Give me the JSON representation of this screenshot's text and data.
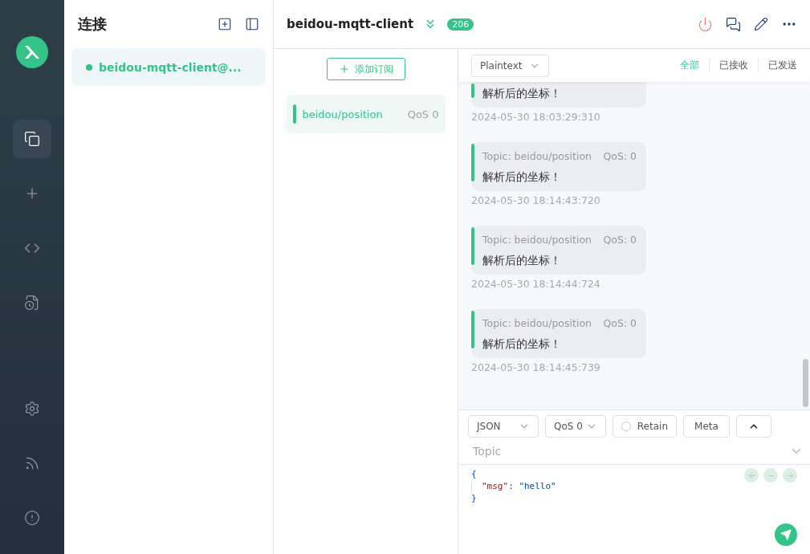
{
  "nav": {
    "items": [
      {
        "kind": "connections",
        "selected": true
      },
      {
        "kind": "new",
        "selected": false
      },
      {
        "kind": "script",
        "selected": false
      },
      {
        "kind": "log",
        "selected": false
      }
    ],
    "bottom": [
      {
        "kind": "settings"
      },
      {
        "kind": "feed"
      },
      {
        "kind": "about"
      }
    ]
  },
  "connections": {
    "title": "连接",
    "items": [
      {
        "name": "beidou-mqtt-client@...",
        "connected": true,
        "selected": true
      }
    ]
  },
  "header": {
    "title": "beidou-mqtt-client",
    "badge": "206"
  },
  "subscriptions": {
    "add_label": "添加订阅",
    "items": [
      {
        "topic": "beidou/position",
        "qos": "QoS 0",
        "color": "#34c388"
      }
    ]
  },
  "messages": {
    "format": "Plaintext",
    "filters": [
      {
        "label": "全部",
        "selected": true
      },
      {
        "label": "已接收",
        "selected": false
      },
      {
        "label": "已发送",
        "selected": false
      }
    ],
    "items": [
      {
        "payload": "解析后的坐标！",
        "time": "2024-05-30 18:03:29:310"
      },
      {
        "topic": "Topic: beidou/position",
        "qos": "QoS: 0",
        "payload": "解析后的坐标！",
        "time": "2024-05-30 18:14:43:720"
      },
      {
        "topic": "Topic: beidou/position",
        "qos": "QoS: 0",
        "payload": "解析后的坐标！",
        "time": "2024-05-30 18:14:44:724"
      },
      {
        "topic": "Topic: beidou/position",
        "qos": "QoS: 0",
        "payload": "解析后的坐标！",
        "time": "2024-05-30 18:14:45:739"
      }
    ]
  },
  "composer": {
    "format": "JSON",
    "qos": "QoS 0",
    "retain": {
      "label": "Retain",
      "checked": false
    },
    "meta": "Meta",
    "topic_placeholder": "Topic",
    "code": [
      [
        {
          "kind": "brace",
          "text": "{"
        }
      ],
      [
        {
          "kind": "key",
          "text": "\"msg\""
        },
        {
          "kind": "punct",
          "text": ": "
        },
        {
          "kind": "string",
          "text": "\"hello\""
        }
      ],
      [
        {
          "kind": "brace",
          "text": "}"
        }
      ]
    ]
  }
}
